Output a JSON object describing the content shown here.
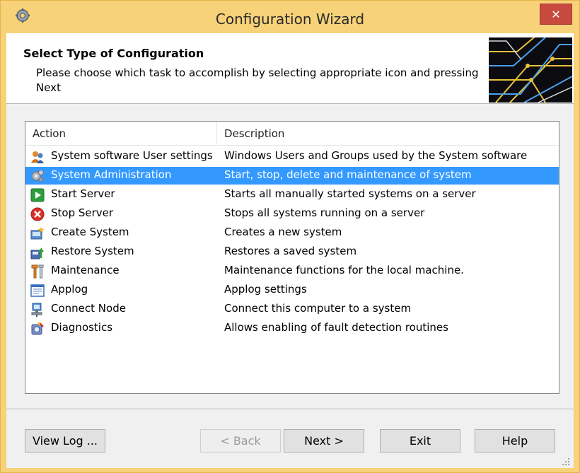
{
  "window": {
    "title": "Configuration Wizard",
    "close_label": "✕"
  },
  "header": {
    "title": "Select Type of Configuration",
    "subtitle": "Please choose which task to accomplish by selecting appropriate icon and pressing Next"
  },
  "list": {
    "columns": [
      "Action",
      "Description"
    ],
    "selected_index": 1,
    "rows": [
      {
        "action": "System software User settings",
        "description": "Windows Users and Groups used by the System software",
        "icon": "users-icon"
      },
      {
        "action": "System Administration",
        "description": "Start, stop, delete and maintenance of system",
        "icon": "gears-icon"
      },
      {
        "action": "Start Server",
        "description": "Starts all manually started systems on a server",
        "icon": "play-icon"
      },
      {
        "action": "Stop Server",
        "description": "Stops all systems running on a server",
        "icon": "stop-icon"
      },
      {
        "action": "Create System",
        "description": "Creates a new system",
        "icon": "new-system-icon"
      },
      {
        "action": "Restore System",
        "description": "Restores a saved system",
        "icon": "restore-icon"
      },
      {
        "action": "Maintenance",
        "description": "Maintenance functions for the local machine.",
        "icon": "tools-icon"
      },
      {
        "action": "Applog",
        "description": "Applog settings",
        "icon": "log-icon"
      },
      {
        "action": "Connect Node",
        "description": "Connect this computer to a system",
        "icon": "network-node-icon"
      },
      {
        "action": "Diagnostics",
        "description": "Allows enabling of fault detection routines",
        "icon": "diagnostics-icon"
      }
    ]
  },
  "buttons": {
    "view_log": "View Log ...",
    "back": "< Back",
    "next": "Next >",
    "exit": "Exit",
    "help": "Help"
  },
  "colors": {
    "title_bar": "#f7d279",
    "selection": "#3399ff",
    "close": "#c74a3f"
  }
}
